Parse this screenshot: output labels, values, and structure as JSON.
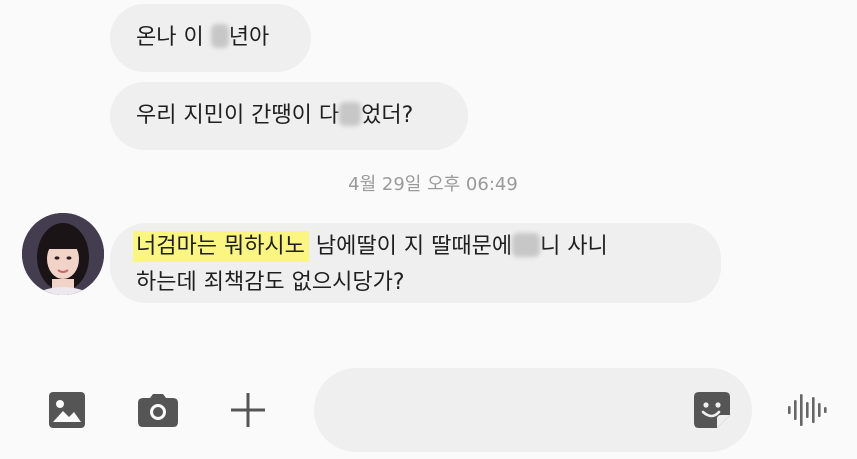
{
  "messages": [
    {
      "id": "msg1",
      "text_before": "온나 이 ",
      "text_after": "년아"
    },
    {
      "id": "msg2",
      "text_before": "우리 지민이 간땡이 다",
      "text_after": "었더?"
    },
    {
      "id": "msg3",
      "highlight": "너검마는 뭐하시노",
      "line1_rest": " 남에딸이 지 딸때문에",
      "line1_tail": "니 사니",
      "line2": "하는데 죄책감도 없으시당가?"
    }
  ],
  "timestamp": "4월 29일 오후 06:49",
  "toolbar": {
    "icons": [
      "gallery-icon",
      "camera-icon",
      "plus-icon",
      "sticker-icon",
      "voice-icon"
    ]
  },
  "colors": {
    "bubble": "#efefef",
    "highlight": "#fbf682",
    "background": "#fafafa",
    "icon": "#555555",
    "timestamp": "#9a9a9a"
  }
}
